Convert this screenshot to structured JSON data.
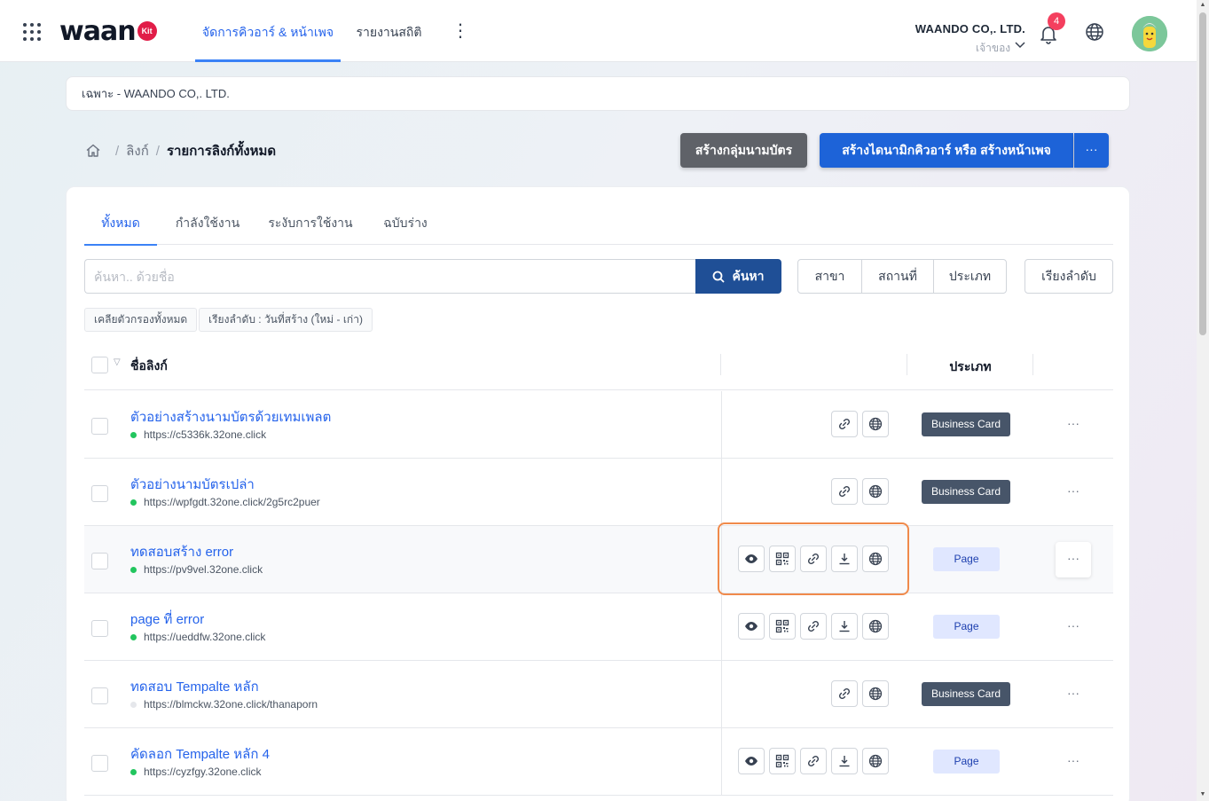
{
  "app": {
    "logo_text": "waan",
    "logo_badge": "Kit"
  },
  "nav": {
    "tabs": [
      {
        "label": "จัดการคิวอาร์ & หน้าเพจ",
        "active": true
      },
      {
        "label": "รายงานสถิติ",
        "active": false
      }
    ],
    "more_icon": "vertical-dots-icon"
  },
  "header": {
    "company_name": "WAANDO CO,. LTD.",
    "company_role": "เจ้าของ",
    "notification_count": "4"
  },
  "scope": {
    "text": "เฉพาะ - WAANDO CO,. LTD."
  },
  "breadcrumb": {
    "items": [
      "ลิงก์"
    ],
    "current": "รายการลิงก์ทั้งหมด"
  },
  "actions": {
    "group_card_label": "สร้างกลุ่มนามบัตร",
    "create_label": "สร้างไดนามิกคิวอาร์ หรือ สร้างหน้าเพจ",
    "more_label": "···"
  },
  "tabs": [
    {
      "label": "ทั้งหมด",
      "active": true
    },
    {
      "label": "กำลังใช้งาน",
      "active": false
    },
    {
      "label": "ระงับการใช้งาน",
      "active": false
    },
    {
      "label": "ฉบับร่าง",
      "active": false
    }
  ],
  "search": {
    "placeholder": "ค้นหา.. ด้วยชื่อ",
    "button_label": "ค้นหา"
  },
  "filters": [
    "สาขา",
    "สถานที่",
    "ประเภท"
  ],
  "sort_label": "เรียงลำดับ",
  "chips": [
    "เคลียตัวกรองทั้งหมด",
    "เรียงลำดับ : วันที่สร้าง (ใหม่ - เก่า)"
  ],
  "table": {
    "columns": {
      "name": "ชื่อลิงก์",
      "type": "ประเภท"
    },
    "rows": [
      {
        "title": "ตัวอย่างสร้างนามบัตรด้วยเทมเพลต",
        "url": "https://c5336k.32one.click",
        "active": true,
        "type": "Business Card",
        "actions": [
          "link-icon",
          "globe-icon"
        ]
      },
      {
        "title": "ตัวอย่างนามบัตรเปล่า",
        "url": "https://wpfgdt.32one.click/2g5rc2puer",
        "active": true,
        "type": "Business Card",
        "actions": [
          "link-icon",
          "globe-icon"
        ]
      },
      {
        "title": "ทดสอบสร้าง error",
        "url": "https://pv9vel.32one.click",
        "active": true,
        "type": "Page",
        "actions": [
          "eye-icon",
          "qr-code-icon",
          "link-icon",
          "download-icon",
          "globe-icon"
        ]
      },
      {
        "title": "page ที่ error",
        "url": "https://ueddfw.32one.click",
        "active": true,
        "type": "Page",
        "actions": [
          "eye-icon",
          "qr-code-icon",
          "link-icon",
          "download-icon",
          "globe-icon"
        ]
      },
      {
        "title": "ทดสอบ Tempalte หลัก",
        "url": "https://blmckw.32one.click/thanaporn",
        "active": false,
        "type": "Business Card",
        "actions": [
          "link-icon",
          "globe-icon"
        ]
      },
      {
        "title": "คัดลอก Tempalte หลัก 4",
        "url": "https://cyzfgy.32one.click",
        "active": true,
        "type": "Page",
        "actions": [
          "eye-icon",
          "qr-code-icon",
          "link-icon",
          "download-icon",
          "globe-icon"
        ]
      }
    ],
    "row_more_label": "···"
  },
  "colors": {
    "primary": "#1d63d8",
    "search_button": "#1f4f96",
    "link_text": "#2563eb",
    "business_card_badge": "#475569",
    "page_badge": "#e0e7ff",
    "highlight_outline": "#f08a4b",
    "notification_badge": "#f43f5e",
    "active_dot": "#22c55e"
  }
}
